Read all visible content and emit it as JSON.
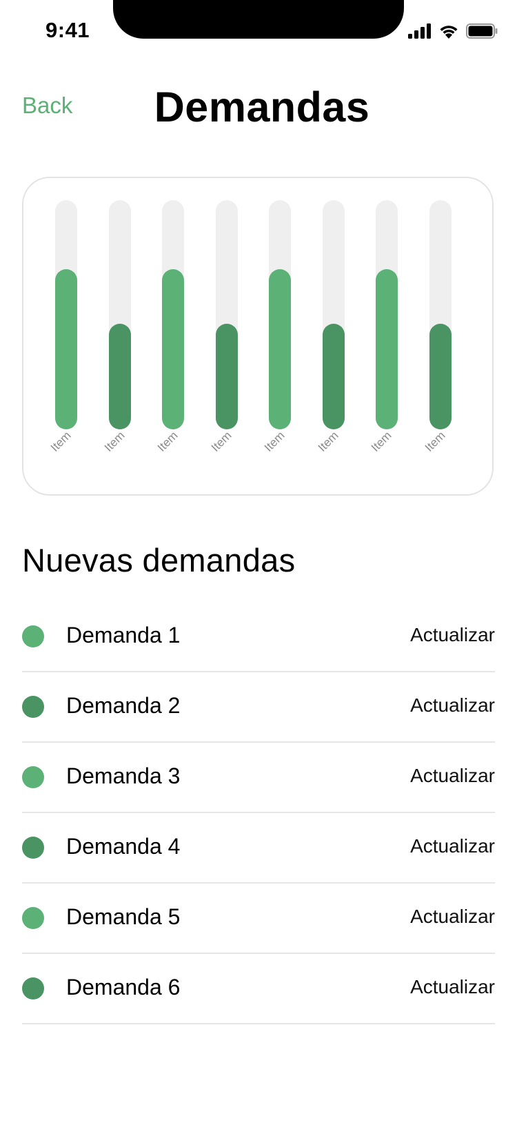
{
  "status_bar": {
    "time": "9:41"
  },
  "header": {
    "back_label": "Back",
    "title": "Demandas"
  },
  "colors": {
    "accent": "#5cb176",
    "light_green": "#5cb176",
    "dark_green": "#4a9362",
    "track": "#efefef"
  },
  "chart_data": {
    "type": "bar",
    "categories": [
      "Item",
      "Item",
      "Item",
      "Item",
      "Item",
      "Item",
      "Item",
      "Item"
    ],
    "values": [
      70,
      46,
      70,
      46,
      70,
      46,
      70,
      46
    ],
    "ylim": [
      0,
      100
    ],
    "bar_colors": [
      "#5cb176",
      "#4a9362",
      "#5cb176",
      "#4a9362",
      "#5cb176",
      "#4a9362",
      "#5cb176",
      "#4a9362"
    ],
    "grid": false
  },
  "section": {
    "title": "Nuevas demandas"
  },
  "demands": [
    {
      "label": "Demanda 1",
      "action": "Actualizar",
      "color": "#5cb176"
    },
    {
      "label": "Demanda 2",
      "action": "Actualizar",
      "color": "#4a9362"
    },
    {
      "label": "Demanda 3",
      "action": "Actualizar",
      "color": "#5cb176"
    },
    {
      "label": "Demanda 4",
      "action": "Actualizar",
      "color": "#4a9362"
    },
    {
      "label": "Demanda 5",
      "action": "Actualizar",
      "color": "#5cb176"
    },
    {
      "label": "Demanda 6",
      "action": "Actualizar",
      "color": "#4a9362"
    }
  ]
}
